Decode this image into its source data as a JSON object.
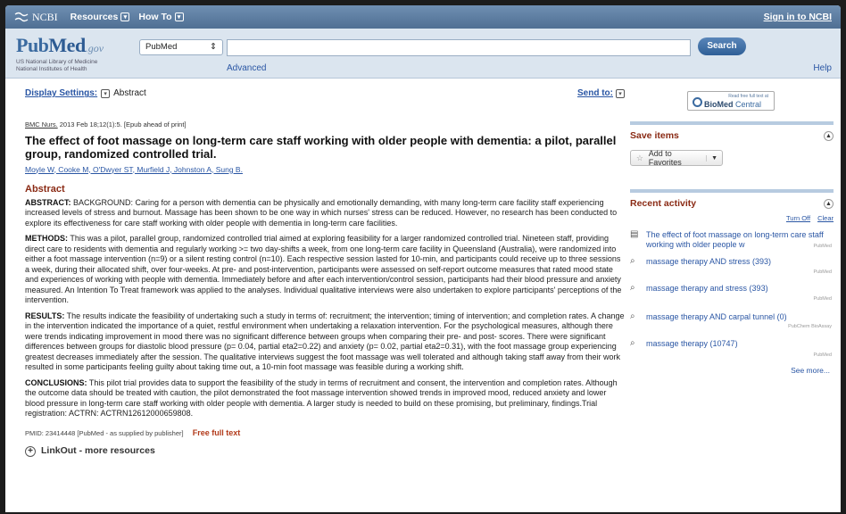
{
  "topbar": {
    "logo": "NCBI",
    "resources": "Resources",
    "howto": "How To",
    "signin": "Sign in to NCBI"
  },
  "header": {
    "logo_pub": "Pub",
    "logo_med": "Med",
    "logo_gov": ".gov",
    "library_line1": "US National Library of Medicine",
    "library_line2": "National Institutes of Health",
    "database": "PubMed",
    "search_value": "",
    "search_button": "Search",
    "advanced": "Advanced",
    "help": "Help"
  },
  "display": {
    "settings_label": "Display Settings:",
    "format": "Abstract",
    "send_to": "Send to:"
  },
  "article": {
    "journal": "BMC Nurs.",
    "citation": " 2013 Feb 18;12(1):5. [Epub ahead of print]",
    "title": "The effect of foot massage on long-term care staff working with older people with dementia: a pilot, parallel group, randomized controlled trial.",
    "authors": "Moyle W, Cooke M, O'Dwyer ST, Murfield J, Johnston A, Sung B.",
    "abstract_heading": "Abstract",
    "sections": [
      {
        "label": "ABSTRACT:",
        "text": " BACKGROUND: Caring for a person with dementia can be physically and emotionally demanding, with many long-term care facility staff experiencing increased levels of stress and burnout. Massage has been shown to be one way in which nurses' stress can be reduced. However, no research has been conducted to explore its effectiveness for care staff working with older people with dementia in long-term care facilities."
      },
      {
        "label": "METHODS:",
        "text": " This was a pilot, parallel group, randomized controlled trial aimed at exploring feasibility for a larger randomized controlled trial. Nineteen staff, providing direct care to residents with dementia and regularly working >= two day-shifts a week, from one long-term care facility in Queensland (Australia), were randomized into either a foot massage intervention (n=9) or a silent resting control (n=10). Each respective session lasted for 10-min, and participants could receive up to three sessions a week, during their allocated shift, over four-weeks. At pre- and post-intervention, participants were assessed on self-report outcome measures that rated mood state and experiences of working with people with dementia. Immediately before and after each intervention/control session, participants had their blood pressure and anxiety measured. An Intention To Treat framework was applied to the analyses. Individual qualitative interviews were also undertaken to explore participants' perceptions of the intervention."
      },
      {
        "label": "RESULTS:",
        "text": " The results indicate the feasibility of undertaking such a study in terms of: recruitment; the intervention; timing of intervention; and completion rates. A change in the intervention indicated the importance of a quiet, restful environment when undertaking a relaxation intervention. For the psychological measures, although there were trends indicating improvement in mood there was no significant difference between groups when comparing their pre- and post- scores. There were significant differences between groups for diastolic blood pressure (p= 0.04, partial eta2=0.22) and anxiety (p= 0.02, partial eta2=0.31), with the foot massage group experiencing greatest decreases immediately after the session. The qualitative interviews suggest the foot massage was well tolerated and although taking staff away from their work resulted in some participants feeling guilty about taking time out, a 10-min foot massage was feasible during a working shift."
      },
      {
        "label": "CONCLUSIONS:",
        "text": " This pilot trial provides data to support the feasibility of the study in terms of recruitment and consent, the intervention and completion rates. Although the outcome data should be treated with caution, the pilot demonstrated the foot massage intervention showed trends in improved mood, reduced anxiety and lower blood pressure in long-term care staff working with older people with dementia. A larger study is needed to build on these promising, but preliminary, findings.Trial registration: ACTRN: ACTRN12612000659808."
      }
    ],
    "pmid_text": "PMID: 23414448 [PubMed - as supplied by publisher]",
    "free_full_text": "Free full text",
    "linkout": "LinkOut - more resources"
  },
  "sidebar": {
    "biomed_tagline": "Read free full text at",
    "biomed_brand": "BioMed",
    "biomed_central": " Central",
    "save_items": "Save items",
    "add_favorites": "Add to Favorites",
    "recent_activity": "Recent activity",
    "turn_off": "Turn Off",
    "clear": "Clear",
    "items": [
      {
        "icon": "document-icon",
        "text": "The effect of foot massage on long-term care staff working with older people w",
        "source": "PubMed"
      },
      {
        "icon": "search-icon",
        "text": "massage therapy AND stress (393)",
        "source": "PubMed"
      },
      {
        "icon": "search-icon",
        "text": "massage therapy and stress (393)",
        "source": "PubMed"
      },
      {
        "icon": "search-icon",
        "text": "massage therapy AND carpal tunnel (0)",
        "source": "PubChem BioAssay"
      },
      {
        "icon": "search-icon",
        "text": "massage therapy (10747)",
        "source": "PubMed"
      }
    ],
    "see_more": "See more..."
  }
}
